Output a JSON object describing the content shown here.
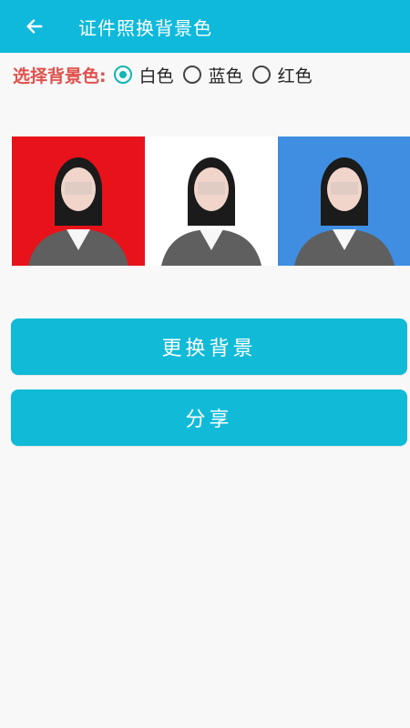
{
  "header": {
    "title": "证件照换背景色",
    "back_icon": "arrow-left-icon"
  },
  "selector": {
    "label": "选择背景色:",
    "options": [
      {
        "label": "白色",
        "checked": true
      },
      {
        "label": "蓝色",
        "checked": false
      },
      {
        "label": "红色",
        "checked": false
      }
    ]
  },
  "photos": [
    {
      "bg": "#e8121b"
    },
    {
      "bg": "#ffffff"
    },
    {
      "bg": "#3f8ee2"
    }
  ],
  "buttons": {
    "change_bg": "更换背景",
    "share": "分享"
  },
  "colors": {
    "accent": "#0fb9db",
    "label": "#e0524d",
    "radio": "#11b6b4"
  }
}
